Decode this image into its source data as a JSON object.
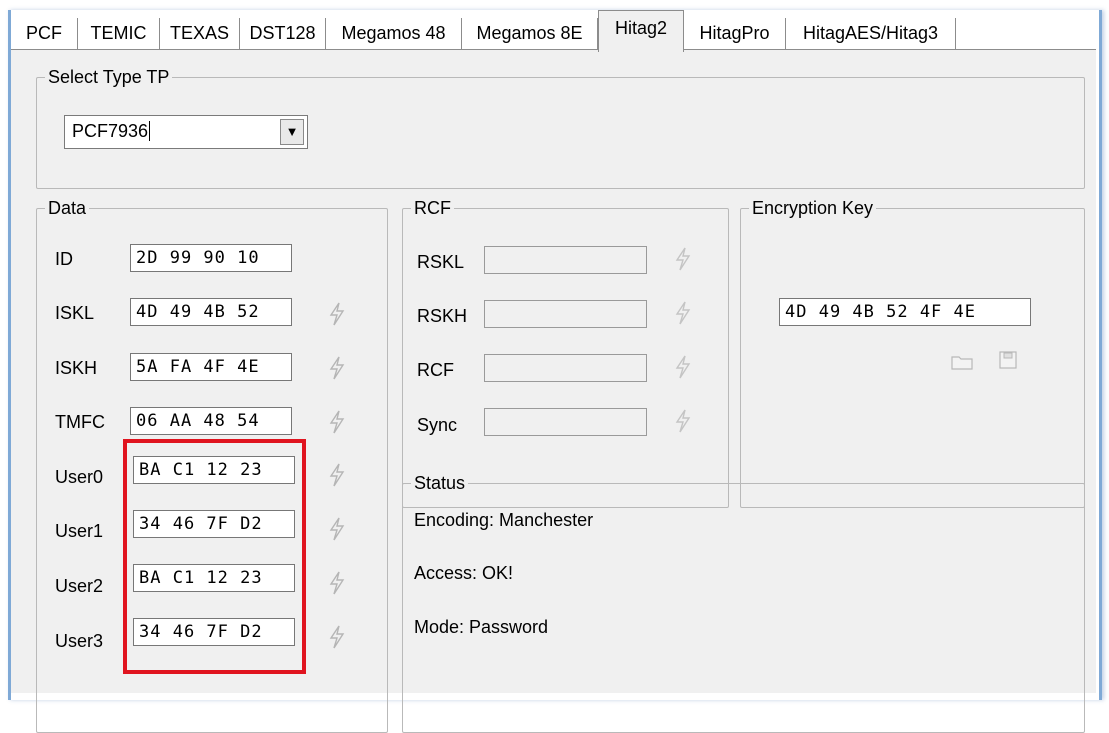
{
  "tabs": [
    "PCF",
    "TEMIC",
    "TEXAS",
    "DST128",
    "Megamos 48",
    "Megamos 8E",
    "Hitag2",
    "HitagPro",
    "HitagAES/Hitag3"
  ],
  "active_tab": "Hitag2",
  "select_type": {
    "title": "Select Type TP",
    "value": "PCF7936"
  },
  "data_group": {
    "title": "Data",
    "rows": [
      {
        "label": "ID",
        "value": "2D 99 90 10"
      },
      {
        "label": "ISKL",
        "value": "4D 49 4B 52"
      },
      {
        "label": "ISKH",
        "value": "5A FA 4F 4E"
      },
      {
        "label": "TMFC",
        "value": "06 AA 48 54"
      },
      {
        "label": "User0",
        "value": "BA C1 12 23"
      },
      {
        "label": "User1",
        "value": "34 46 7F D2"
      },
      {
        "label": "User2",
        "value": "BA C1 12 23"
      },
      {
        "label": "User3",
        "value": "34 46 7F D2"
      }
    ]
  },
  "rcf_group": {
    "title": "RCF",
    "rows": [
      {
        "label": "RSKL",
        "value": ""
      },
      {
        "label": "RSKH",
        "value": ""
      },
      {
        "label": "RCF",
        "value": ""
      },
      {
        "label": "Sync",
        "value": ""
      }
    ]
  },
  "encryption_group": {
    "title": "Encryption Key",
    "value": "4D 49 4B 52 4F 4E"
  },
  "status_group": {
    "title": "Status",
    "lines": [
      "Encoding: Manchester",
      "Access: OK!",
      "Mode: Password"
    ]
  },
  "colors": {
    "highlight": "#e0141f",
    "panel_bg": "#f0f0f0"
  }
}
